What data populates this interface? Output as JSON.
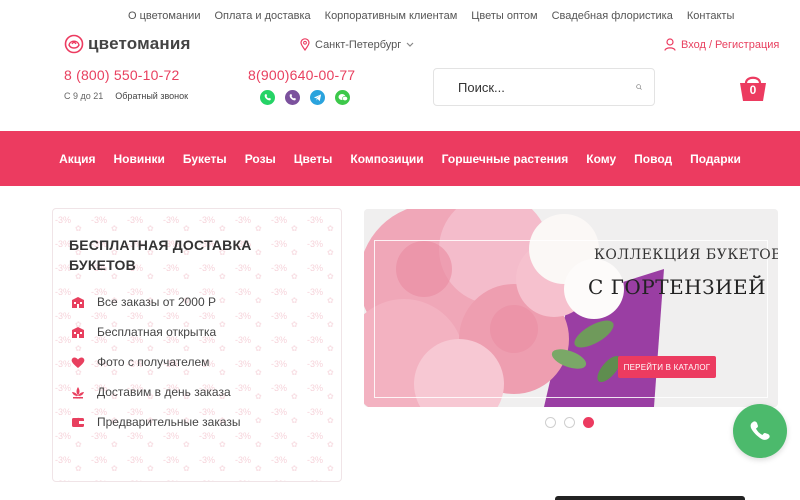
{
  "topnav": [
    "О цветомании",
    "Оплата и доставка",
    "Корпоративным клиентам",
    "Цветы оптом",
    "Свадебная флористика",
    "Контакты"
  ],
  "logo": {
    "text": "цветомания",
    "icon": "rose-logo-icon"
  },
  "city": {
    "label": "Санкт-Петербург",
    "icon": "location-pin-icon"
  },
  "login": {
    "label": "Вход / Регистрация",
    "icon": "user-icon"
  },
  "contacts": {
    "phone1": "8 (800) 550-10-72",
    "hours": "С 9 до 21",
    "callback": "Обратный звонок",
    "phone2": "8(900)640-00-77",
    "messengers": [
      {
        "name": "whatsapp-icon",
        "color": "#25d366",
        "glyph": "✆"
      },
      {
        "name": "viber-icon",
        "color": "#7b519d",
        "glyph": "✆"
      },
      {
        "name": "telegram-icon",
        "color": "#2aa3dd",
        "glyph": "➤"
      },
      {
        "name": "wechat-icon",
        "color": "#3cc84a",
        "glyph": "●"
      }
    ]
  },
  "search": {
    "placeholder": "Поиск...",
    "icon": "search-icon"
  },
  "cart": {
    "count": "0",
    "icon": "basket-icon"
  },
  "mainnav": [
    "Акция",
    "Новинки",
    "Букеты",
    "Розы",
    "Цветы",
    "Композиции",
    "Горшечные растения",
    "Кому",
    "Повод",
    "Подарки"
  ],
  "delivery": {
    "title": "БЕСПЛАТНАЯ ДОСТАВКА БУКЕТОВ",
    "watermark": "-3%",
    "features": [
      {
        "label": "Все заказы от 2000 Р",
        "icon": "building-icon"
      },
      {
        "label": "Бесплатная открытка",
        "icon": "building-icon"
      },
      {
        "label": "Фото с получателем",
        "icon": "heart-icon"
      },
      {
        "label": "Доставим в день заказа",
        "icon": "lotus-icon"
      },
      {
        "label": "Предварительные заказы",
        "icon": "wallet-icon"
      }
    ]
  },
  "banner": {
    "title_line1": "КОЛЛЕКЦИЯ БУКЕТОВ",
    "title_line2": "С ГОРТЕНЗИЕЙ",
    "button": "ПЕРЕЙТИ В КАТАЛОГ",
    "slides_total": 3,
    "slide_active": 3
  },
  "colors": {
    "accent": "#ec3b60",
    "call_button": "#4cba6c"
  },
  "call_button": {
    "icon": "phone-icon"
  }
}
